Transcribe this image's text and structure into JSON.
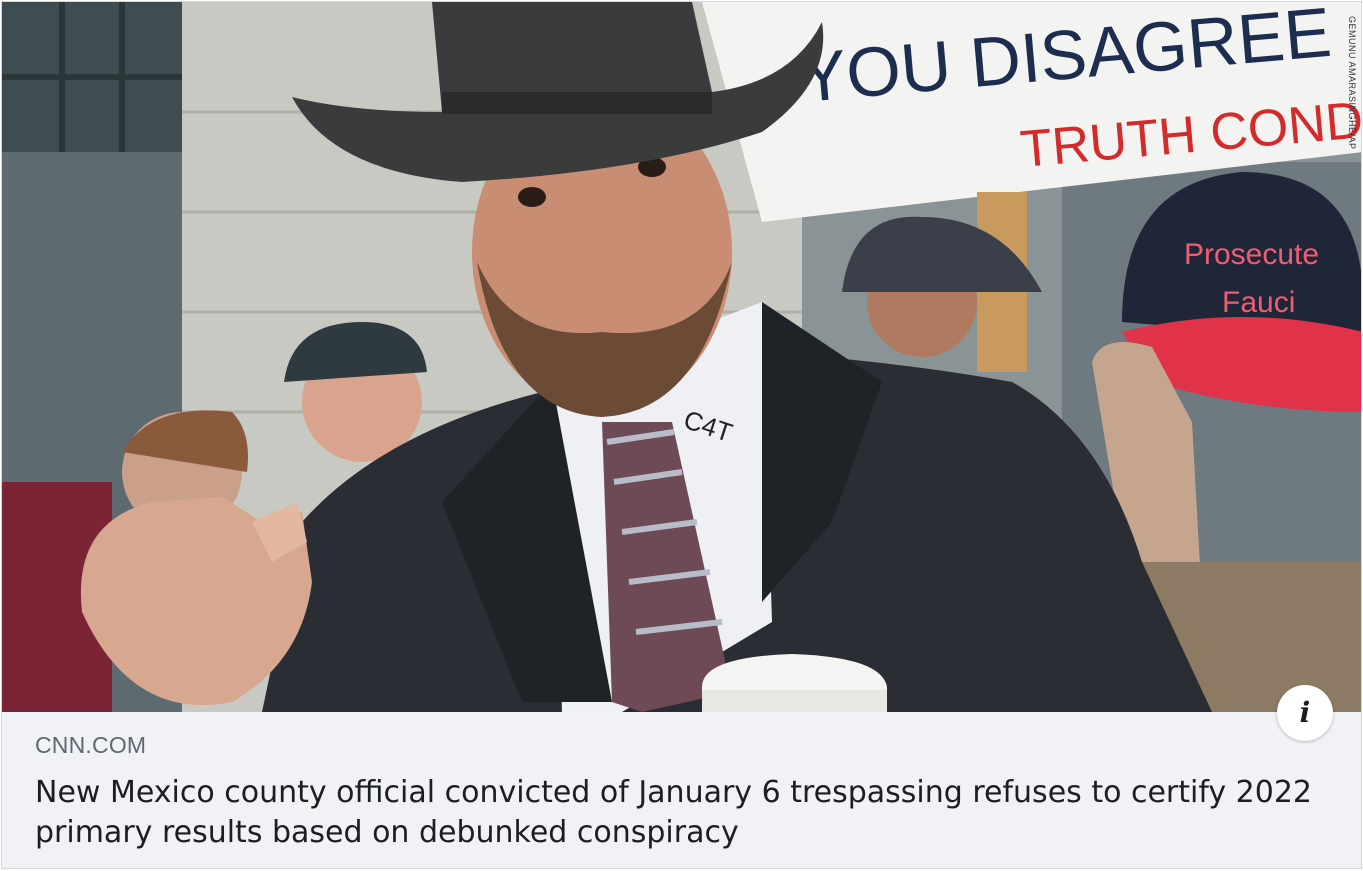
{
  "link_preview": {
    "image": {
      "description_icon": "news-photo",
      "credit": "GEMUNU AMARASINGHE/AP",
      "sign_text_line1": "YOU DISAGREE",
      "sign_text_line2": "TRUTH COND",
      "cap_text_line1": "Prosecute",
      "cap_text_line2": "Fauci",
      "collar_text": "C4T"
    },
    "info_button_glyph": "i",
    "source_domain": "CNN.COM",
    "headline": "New Mexico county official convicted of January 6 trespassing refuses to certify 2022 primary results based on debunked conspiracy"
  },
  "colors": {
    "card_bg": "#f0f2f5",
    "headline_text": "#1c1e21",
    "domain_text": "#606770",
    "sign_red": "#d32a2a"
  }
}
